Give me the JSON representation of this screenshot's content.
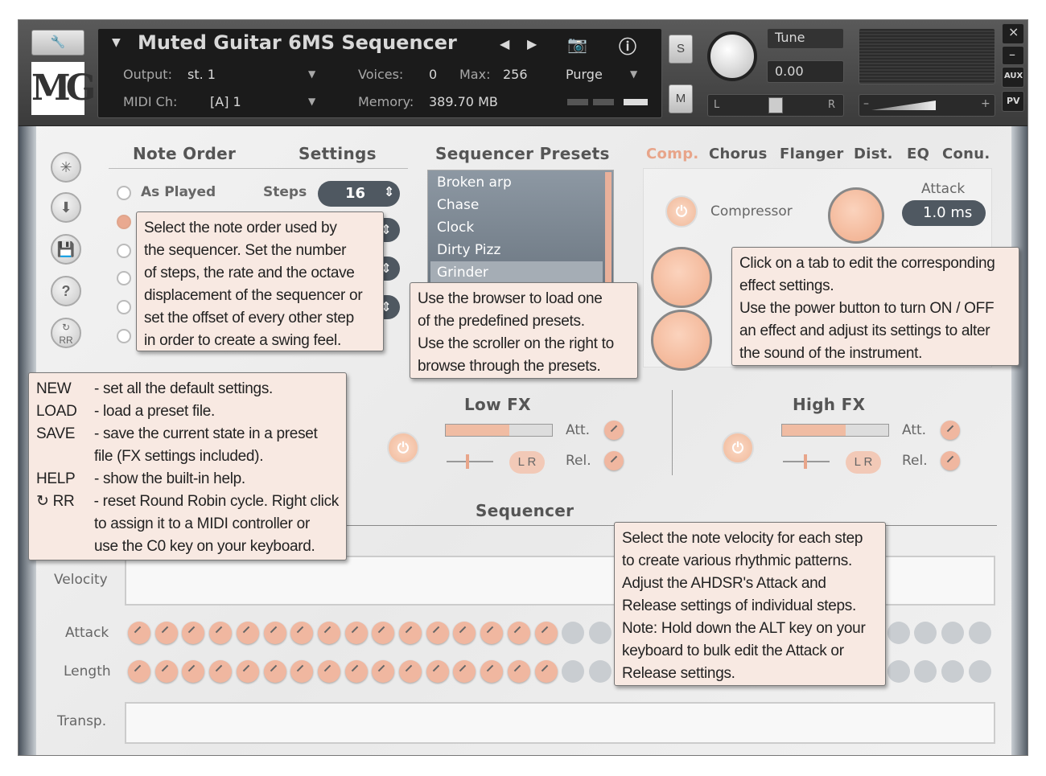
{
  "header": {
    "instrument_name": "Muted Guitar 6MS Sequencer",
    "output_label": "Output:",
    "output_value": "st. 1",
    "voices_label": "Voices:",
    "voices_value": "0",
    "max_label": "Max:",
    "max_value": "256",
    "purge_label": "Purge",
    "midi_label": "MIDI Ch:",
    "midi_value": "[A] 1",
    "memory_label": "Memory:",
    "memory_value": "389.70 MB",
    "tune_label": "Tune",
    "tune_value": "0.00",
    "s_label": "S",
    "m_label": "M",
    "l_label": "L",
    "r_label": "R",
    "aux_label": "AUX",
    "pv_label": "PV",
    "close": "×",
    "minimize": "–",
    "logo": "MG"
  },
  "note_order": {
    "title": "Note Order",
    "options": [
      "As Played",
      "",
      "",
      "",
      "",
      ""
    ]
  },
  "settings": {
    "title": "Settings",
    "steps_label": "Steps",
    "steps_value": "16"
  },
  "presets": {
    "title": "Sequencer Presets",
    "items": [
      "Broken arp",
      "Chase",
      "Clock",
      "Dirty Pizz",
      "Grinder"
    ]
  },
  "fx_tabs": [
    "Comp.",
    "Chorus",
    "Flanger",
    "Dist.",
    "EQ",
    "Conu."
  ],
  "compressor": {
    "label": "Compressor",
    "attack_label": "Attack",
    "attack_value": "1.0 ms"
  },
  "low_fx": {
    "title": "Low FX",
    "att": "Att.",
    "rel": "Rel.",
    "lr": "L R"
  },
  "high_fx": {
    "title": "High FX",
    "att": "Att.",
    "rel": "Rel.",
    "lr": "L R"
  },
  "sequencer": {
    "title": "Sequencer",
    "rows": [
      "Velocity",
      "Attack",
      "Length",
      "Transp."
    ],
    "active_steps": 16,
    "total_steps": 32
  },
  "tooltips": {
    "note_order": [
      "Select the note order used by",
      "the sequencer. Set the number",
      "of steps, the rate and the octave",
      "displacement of the sequencer or",
      "set the offset of every other step",
      "in order to create a swing feel."
    ],
    "presets": [
      "Use the browser to load one",
      "of the predefined presets.",
      "Use the scroller on the right to",
      "browse through the presets."
    ],
    "fx": [
      "Click on a tab to edit the corresponding",
      "effect settings.",
      "Use the power button to turn ON / OFF",
      "an effect and adjust its settings to alter",
      "the sound of the instrument."
    ],
    "buttons": [
      {
        "k": "NEW",
        "d": "- set all the default settings."
      },
      {
        "k": "LOAD",
        "d": "- load a preset file."
      },
      {
        "k": "SAVE",
        "d": "- save the current state in a preset"
      },
      {
        "k": "",
        "d": "file (FX settings included)."
      },
      {
        "k": "HELP",
        "d": "- show the built-in help."
      },
      {
        "k": "↻ RR",
        "d": "- reset Round Robin cycle. Right click"
      },
      {
        "k": "",
        "d": "to assign it to a MIDI controller or"
      },
      {
        "k": "",
        "d": "use the C0 key on your keyboard."
      }
    ],
    "sequencer": [
      "Select the note velocity for each step",
      "to create various rhythmic patterns.",
      "Adjust the AHDSR's Attack and",
      "Release settings of individual steps.",
      "Note: Hold down the ALT key on your",
      "keyboard to bulk edit the Attack or",
      "Release settings."
    ]
  }
}
